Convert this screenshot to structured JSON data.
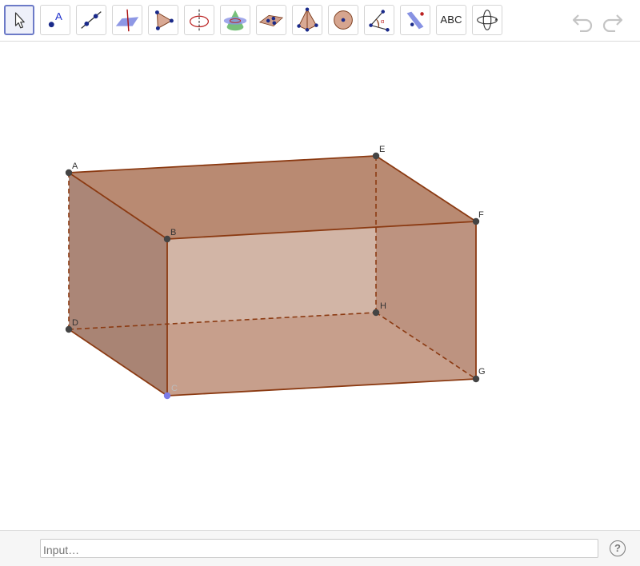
{
  "toolbar": {
    "tools": [
      {
        "name": "move-tool-icon"
      },
      {
        "name": "point-tool-icon",
        "label": "A"
      },
      {
        "name": "line-tool-icon"
      },
      {
        "name": "perpendicular-line-tool-icon"
      },
      {
        "name": "polygon-tool-icon"
      },
      {
        "name": "circle-axis-tool-icon"
      },
      {
        "name": "intersect-surfaces-tool-icon"
      },
      {
        "name": "plane-tool-icon"
      },
      {
        "name": "pyramid-tool-icon"
      },
      {
        "name": "sphere-tool-icon"
      },
      {
        "name": "angle-tool-icon",
        "label": "α"
      },
      {
        "name": "reflect-tool-icon"
      },
      {
        "name": "text-tool",
        "label": "ABC"
      },
      {
        "name": "rotate-view-tool-icon"
      }
    ],
    "undo_icon": "undo-icon",
    "redo_icon": "redo-icon"
  },
  "graphics": {
    "points": [
      {
        "name": "A",
        "label": "A"
      },
      {
        "name": "B",
        "label": "B"
      },
      {
        "name": "C",
        "label": "C"
      },
      {
        "name": "D",
        "label": "D"
      },
      {
        "name": "E",
        "label": "E"
      },
      {
        "name": "F",
        "label": "F"
      },
      {
        "name": "G",
        "label": "G"
      },
      {
        "name": "H",
        "label": "H"
      }
    ],
    "colors": {
      "edge": "#8b3a12",
      "top_face": "#b98a72",
      "left_face": "#a88272",
      "right_face": "#b08574",
      "bottom_face": "#c9a594",
      "point": "#444444",
      "point_selected": "#7b7be8"
    }
  },
  "input_bar": {
    "placeholder": "Input…",
    "help_label": "?",
    "help_icon": "help-icon"
  }
}
